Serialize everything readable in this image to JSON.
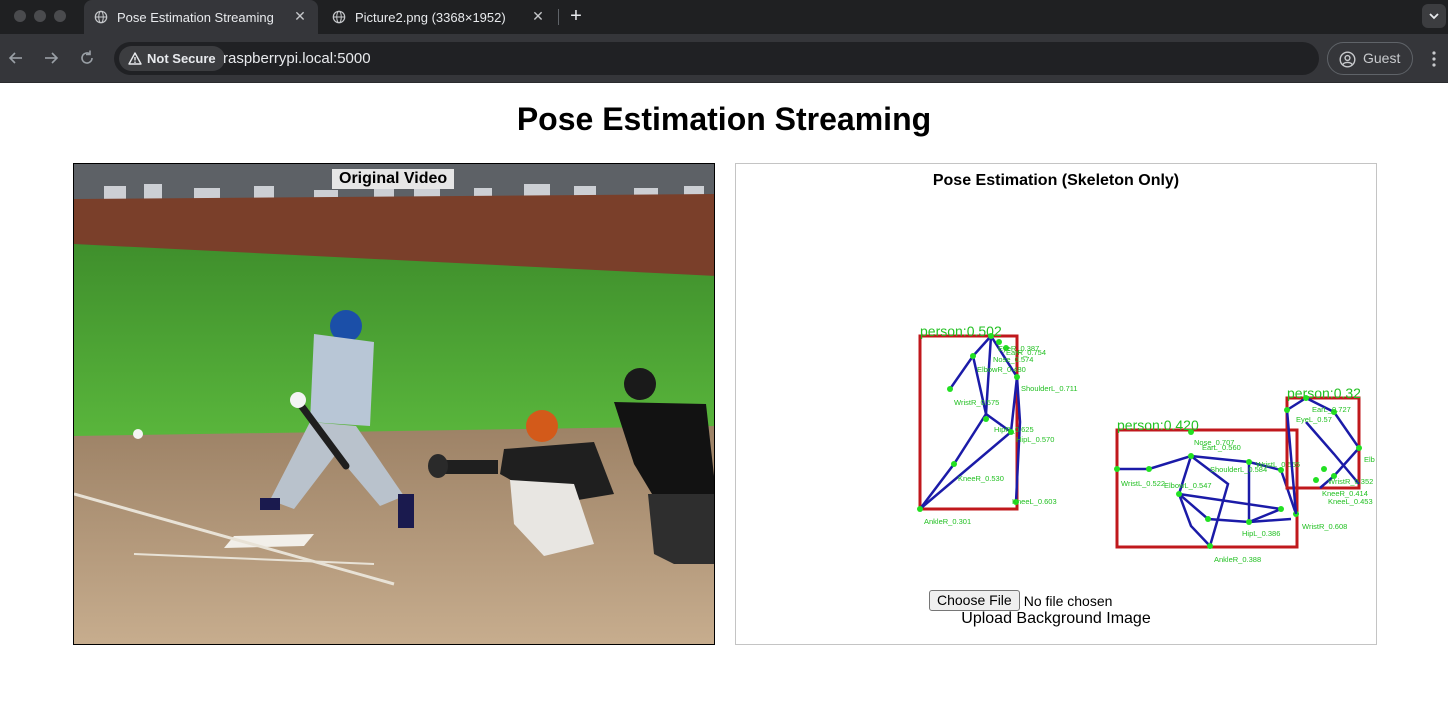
{
  "browser": {
    "tabs": [
      {
        "title": "Pose Estimation Streaming",
        "active": true
      },
      {
        "title": "Picture2.png (3368×1952)",
        "active": false
      }
    ],
    "security_chip": "Not Secure",
    "url": "raspberrypi.local:5000",
    "profile_label": "Guest",
    "icons": [
      "back-arrow-icon",
      "forward-arrow-icon",
      "reload-icon",
      "globe-icon",
      "warning-triangle-icon",
      "profile-icon",
      "more-vert-icon"
    ]
  },
  "page": {
    "title": "Pose Estimation Streaming",
    "video_panel": {
      "label": "Original Video"
    },
    "skeleton_panel": {
      "label": "Pose Estimation (Skeleton Only)",
      "detections": [
        {
          "label": "person:0.502",
          "keypoints": [
            "EyeR_0.387",
            "EarR_0.754",
            "Nose_0.574",
            "ElbowR_0.480",
            "ShoulderL_0.711",
            "WristR_0.575",
            "HipR_0.625",
            "HipL_0.570",
            "KneeR_0.530",
            "KneeL_0.603",
            "AnkleR_0.301"
          ]
        },
        {
          "label": "person:0.420",
          "keypoints": [
            "Nose_0.707",
            "EarL_0.560",
            "ShoulderL_0.584",
            "WristL_0.555",
            "ElbowL_0.547",
            "WristL_0.522",
            "HipL_0.386",
            "WristR_0.608",
            "AnkleR_0.388"
          ]
        },
        {
          "label": "person:0.32",
          "keypoints": [
            "EarL_0.727",
            "EyeL_0.57",
            "WristR_0.352",
            "KneeR_0.414",
            "KneeL_0.453",
            "Elb"
          ]
        }
      ]
    },
    "file_input": {
      "button_label": "Choose File",
      "status": "No file chosen"
    },
    "upload_label": "Upload Background Image"
  },
  "colors": {
    "bbox": "#c0181c",
    "bone": "#1b1ba8",
    "keypoint": "#22e022",
    "chrome_dark": "#1f2022",
    "toolbar": "#35363a"
  }
}
